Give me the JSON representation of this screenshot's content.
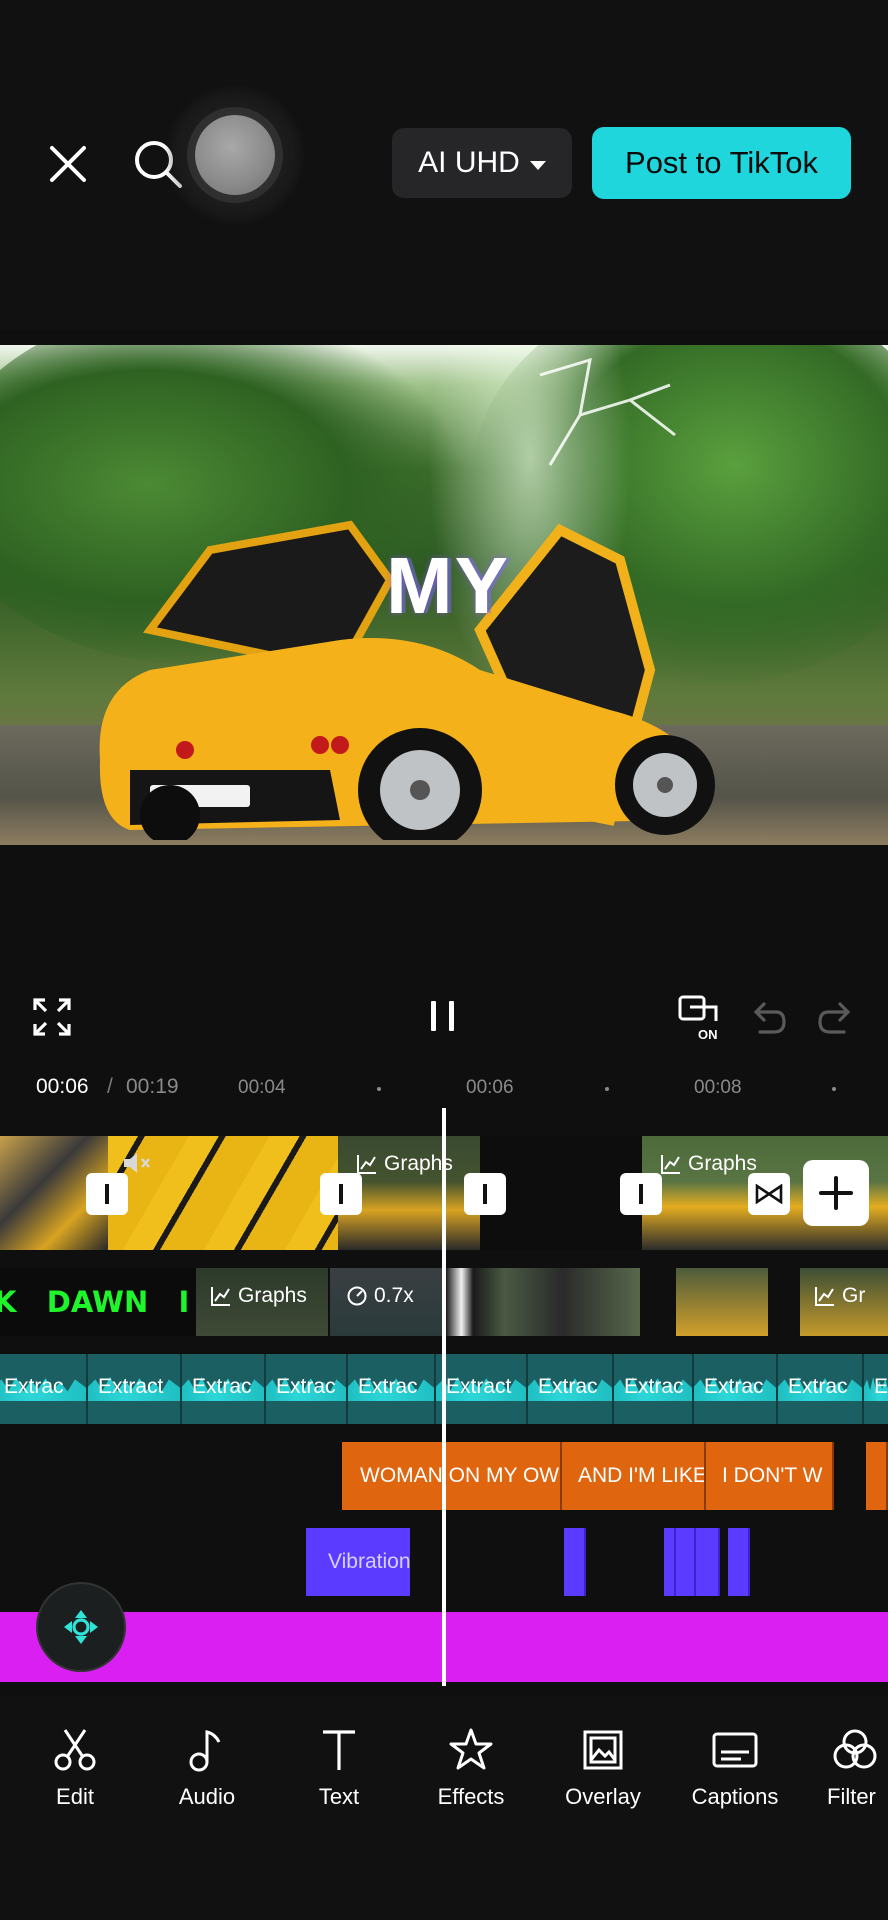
{
  "header": {
    "quality_label": "AI UHD",
    "post_label": "Post to TikTok"
  },
  "preview": {
    "overlay_text": "MY"
  },
  "timeline": {
    "current_time": "00:06",
    "separator": "/",
    "total_time": "00:19",
    "ticks": [
      "00:04",
      "00:06",
      "00:08"
    ]
  },
  "video_track": {
    "clip_labels": [
      "Graphs",
      "Graphs"
    ]
  },
  "overlay_track": {
    "text_clip": "K   DAWN   I",
    "labels": [
      "Graphs",
      "0.7x",
      "Gr"
    ]
  },
  "audio_track": {
    "segments": [
      "Extrac",
      "Extract",
      "Extrac",
      "Extrac",
      "Extrac",
      "Extract",
      "Extrac",
      "Extrac",
      "Extrac",
      "Extrac",
      "E"
    ]
  },
  "text_track": {
    "clips": [
      "WOMAN ON MY OWN",
      "AND I'M LIKE",
      "I DON'T W"
    ]
  },
  "effect_track": {
    "clip_label": "Vibration"
  },
  "toolbar": {
    "items": [
      {
        "label": "Edit",
        "icon": "scissors-icon"
      },
      {
        "label": "Audio",
        "icon": "music-note-icon"
      },
      {
        "label": "Text",
        "icon": "text-icon"
      },
      {
        "label": "Effects",
        "icon": "star-effects-icon"
      },
      {
        "label": "Overlay",
        "icon": "overlay-icon"
      },
      {
        "label": "Captions",
        "icon": "captions-icon"
      },
      {
        "label": "Filter",
        "icon": "filter-icon"
      }
    ]
  },
  "colors": {
    "accent": "#1ed6dc",
    "text_clip": "#e0650f",
    "effect_clip": "#5b3bff",
    "magenta_track": "#d91ff2",
    "audio_wave": "#1fc9cc"
  }
}
